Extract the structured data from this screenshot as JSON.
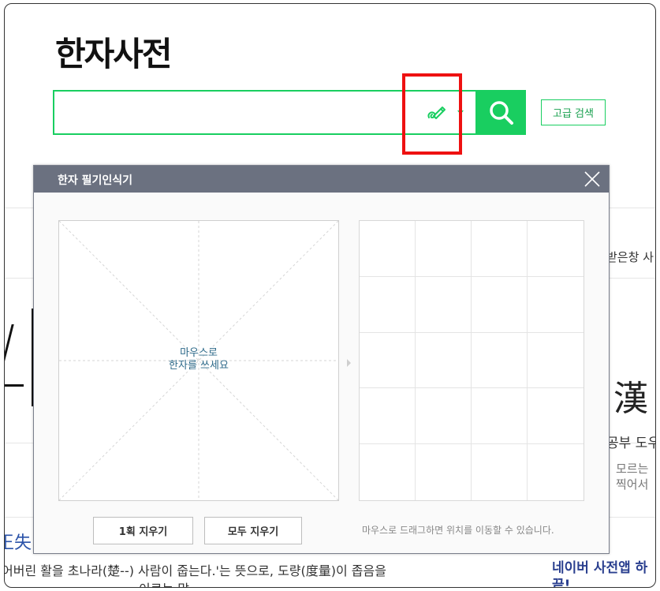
{
  "header": {
    "title": "한자사전",
    "advanced_search_label": "고급 검색"
  },
  "search": {
    "value": "",
    "placeholder": ""
  },
  "modal": {
    "title": "한자 필기인식기",
    "draw_hint_line1": "마우스로",
    "draw_hint_line2": "한자를 쓰세요",
    "erase_one_label": "1획 지우기",
    "erase_all_label": "모두 지우기",
    "help_text": "마우스로 드래그하면 위치를 이동할 수 있습니다."
  },
  "background": {
    "right_snippet_1": "받은창 사",
    "right_hanja": "漢",
    "right_snippet_2": "공부 도우",
    "right_snippet_3": "모르는",
    "right_snippet_4": "찍어서",
    "left_hanja": "王失",
    "bottom_sentence": "어버린 활을 초나라(楚--) 사람이 줍는다.'는 뜻으로, 도량(度量)이 좁음을",
    "bottom_sentence_2": "이르는 말",
    "app_promo_1": "네이버 사전앱 하",
    "app_promo_2": "끝!"
  },
  "colors": {
    "accent_green": "#19ce60",
    "modal_header": "#6b7180",
    "highlight_red": "#ee1111"
  },
  "icons": {
    "handwriting": "handwriting-pen-icon",
    "search": "search-icon",
    "close": "close-icon"
  }
}
